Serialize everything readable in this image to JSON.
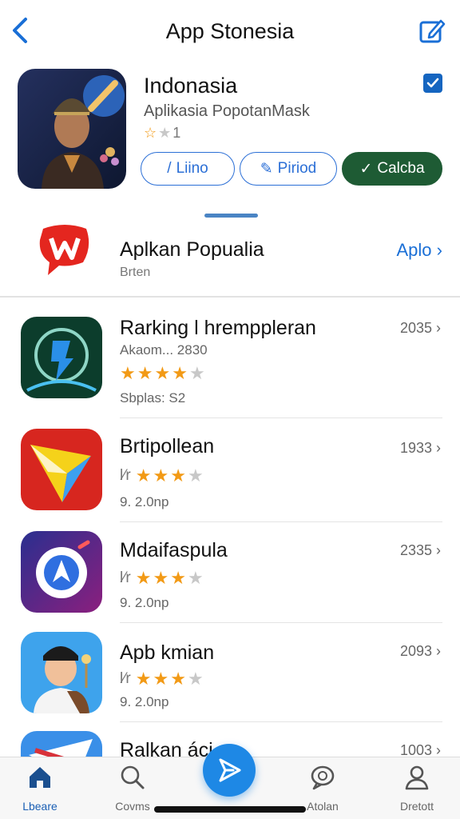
{
  "header": {
    "title": "App Stonesia"
  },
  "hero": {
    "title": "Indonasia",
    "subtitle": "Aplikasia PopotanMask",
    "rating_text": "1",
    "buttons": [
      {
        "label": "Liino"
      },
      {
        "label": "Piriod"
      },
      {
        "label": "Calcba"
      }
    ]
  },
  "section": {
    "title": "Aplkan Popualia",
    "subtitle": "Brten",
    "link": "Aplo"
  },
  "apps": [
    {
      "title": "Rarking l hremppleran",
      "meta": "Akaom...  2830",
      "rating": 4,
      "size": "Sbplas: S2",
      "count": "2035"
    },
    {
      "title": "Brtipollean",
      "meta": "",
      "rating": 3,
      "size": "9. 2.0np",
      "count": "1933"
    },
    {
      "title": "Mdaifaspula",
      "meta": "",
      "rating": 3,
      "size": "9. 2.0np",
      "count": "2335"
    },
    {
      "title": "Apb kmian",
      "meta": "",
      "rating": 3,
      "size": "9. 2.0np",
      "count": "2093"
    },
    {
      "title": "Ralkan áci",
      "meta": "",
      "rating": 0,
      "size": "",
      "count": "1003"
    }
  ],
  "tabbar": {
    "tabs": [
      {
        "label": "Lbeare",
        "icon": "home-icon"
      },
      {
        "label": "Covms",
        "icon": "search-icon"
      },
      {
        "label": "Atolan",
        "icon": "chat-icon"
      },
      {
        "label": "Dretott",
        "icon": "person-icon"
      }
    ],
    "center_icon": "send-icon"
  },
  "colors": {
    "accent": "#2b6fd6",
    "primary_green": "#1e5b34",
    "star": "#f29a16",
    "fab": "#1e88e5"
  }
}
